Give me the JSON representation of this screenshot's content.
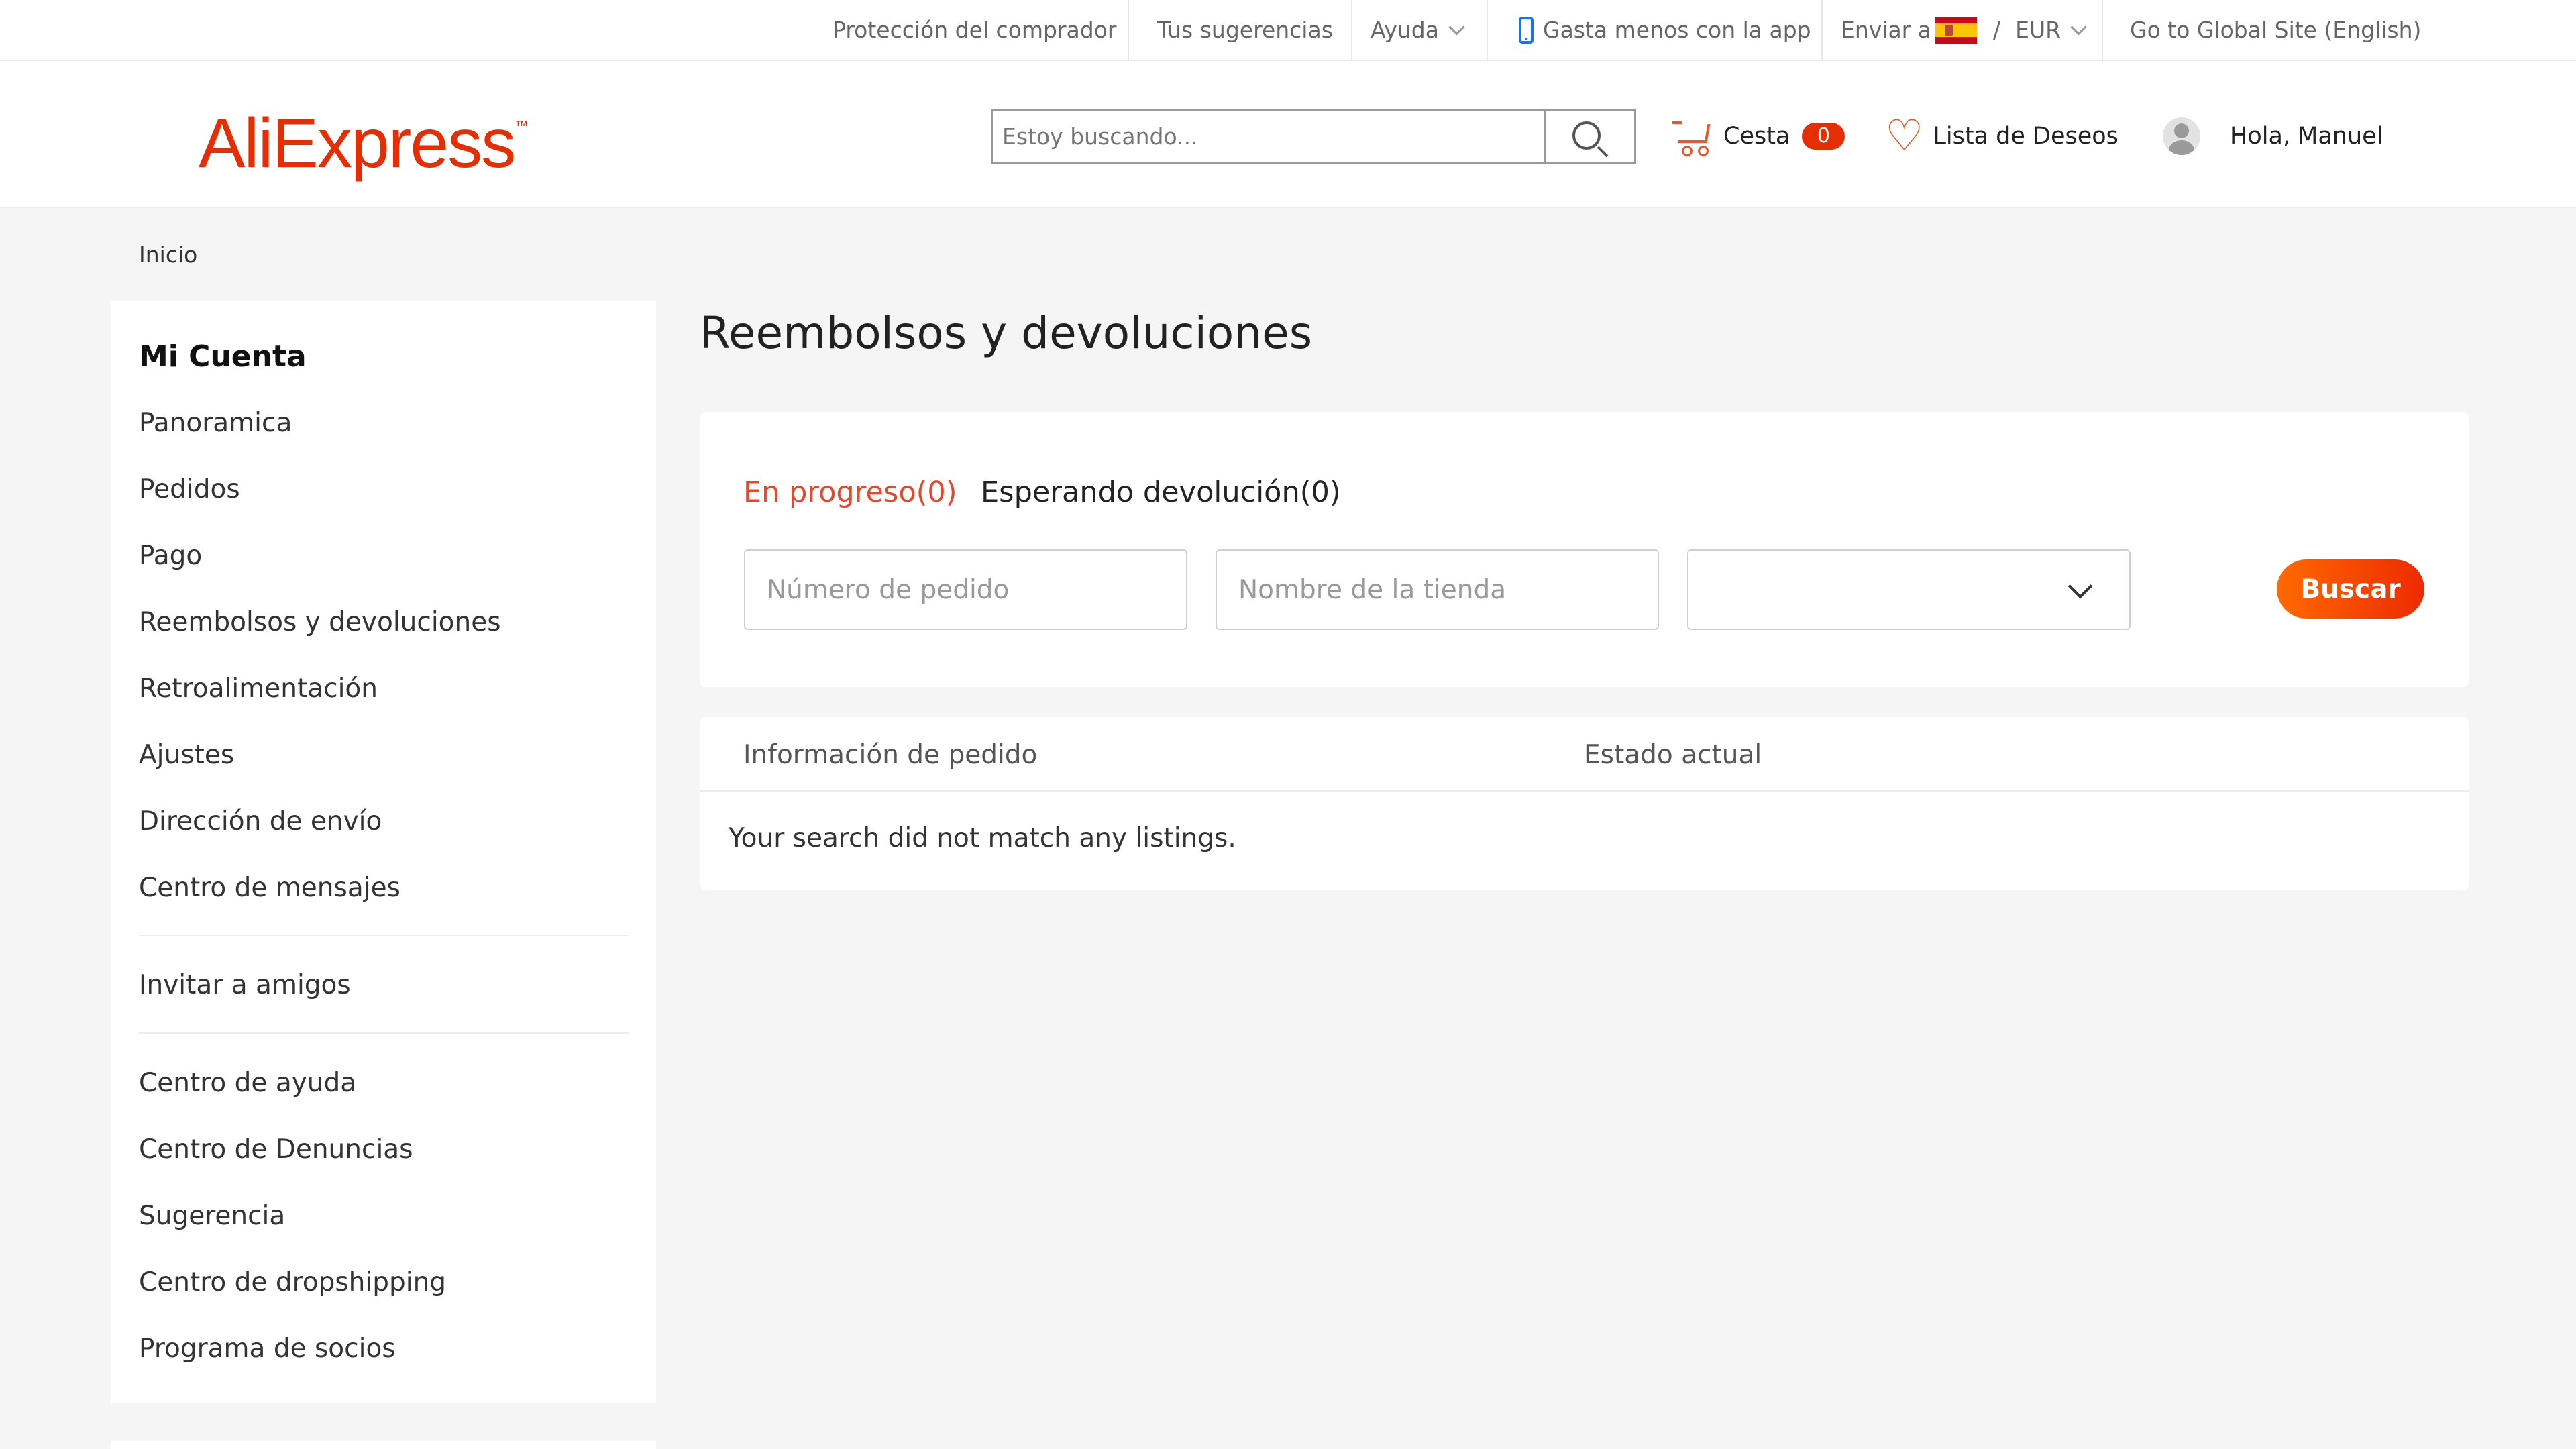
{
  "topbar": {
    "buyer_protection": "Protección del comprador",
    "suggestions": "Tus sugerencias",
    "help": "Ayuda",
    "app_promo": "Gasta menos con la app",
    "ship_to": "Enviar a",
    "currency_sep": "/",
    "currency": "EUR",
    "global_site": "Go to Global Site (English)"
  },
  "header": {
    "logo": "AliExpress",
    "search_placeholder": "Estoy buscando...",
    "cart_label": "Cesta",
    "cart_count": "0",
    "wishlist_label": "Lista de Deseos",
    "greeting": "Hola, Manuel"
  },
  "breadcrumb": {
    "home": "Inicio"
  },
  "sidebar": {
    "title": "Mi Cuenta",
    "items": [
      "Panoramica",
      "Pedidos",
      "Pago",
      "Reembolsos y devoluciones",
      "Retroalimentación",
      "Ajustes",
      "Dirección de envío",
      "Centro de mensajes",
      "Invitar a amigos",
      "Centro de ayuda",
      "Centro de Denuncias",
      "Sugerencia",
      "Centro de dropshipping",
      "Programa de socios"
    ]
  },
  "main": {
    "title": "Reembolsos y devoluciones",
    "tabs": [
      "En progreso(0)",
      "Esperando devolución(0)"
    ],
    "order_number_placeholder": "Número de pedido",
    "store_name_placeholder": "Nombre de la tienda",
    "search_button": "Buscar",
    "columns": [
      "Información de pedido",
      "Estado actual"
    ],
    "empty_message": "Your search did not match any listings."
  },
  "colors": {
    "brand": "#e62e04",
    "active_tab": "#e8472b",
    "button_gradient_start": "#ff6a00",
    "button_gradient_end": "#ee2a00"
  }
}
